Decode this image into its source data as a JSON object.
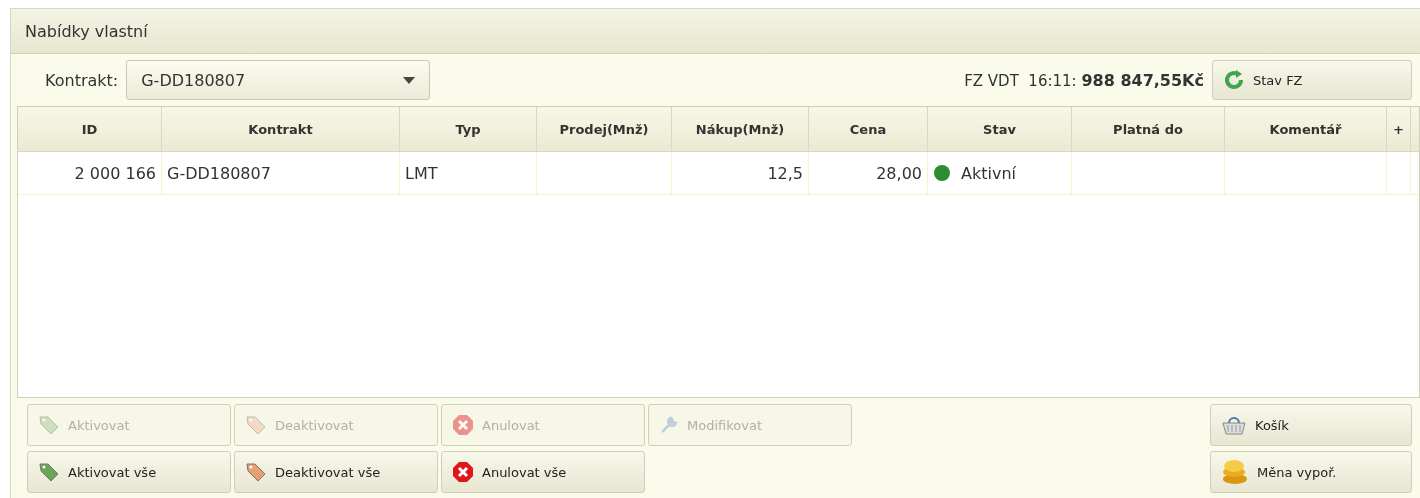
{
  "panel": {
    "title": "Nabídky vlastní"
  },
  "contract": {
    "label": "Kontrakt:",
    "value": "G-DD180807"
  },
  "balance": {
    "label": "FZ VDT  16:11:",
    "amount": "988 847,55Kč"
  },
  "refresh_button": {
    "label": "Stav FZ"
  },
  "table": {
    "columns": [
      {
        "label": "ID",
        "kind": "number"
      },
      {
        "label": "Kontrakt",
        "kind": "text"
      },
      {
        "label": "Typ",
        "kind": "text"
      },
      {
        "label": "Prodej(Mnž)",
        "kind": "number"
      },
      {
        "label": "Nákup(Mnž)",
        "kind": "number"
      },
      {
        "label": "Cena",
        "kind": "number"
      },
      {
        "label": "Stav",
        "kind": "status"
      },
      {
        "label": "Platná do",
        "kind": "text"
      },
      {
        "label": "Komentář",
        "kind": "text"
      }
    ],
    "add_column": "+",
    "rows": [
      {
        "cells": [
          "2 000 166",
          "G-DD180807",
          "LMT",
          "",
          "12,5",
          "28,00",
          "Aktivní",
          "",
          ""
        ],
        "color": "#2e8b2e",
        "selected": false
      }
    ]
  },
  "actions": [
    {
      "label": "Aktivovat",
      "disabled": true
    },
    {
      "label": "Deaktivovat",
      "disabled": true
    },
    {
      "label": "Anulovat",
      "disabled": true
    },
    {
      "label": "Modifikovat",
      "disabled": true
    },
    {
      "label": "Aktivovat vše",
      "disabled": false
    },
    {
      "label": "Deaktivovat vše",
      "disabled": false
    },
    {
      "label": "Anulovat vše",
      "disabled": false
    }
  ],
  "side_actions": [
    {
      "label": "Košík"
    },
    {
      "label": "Měna vypoř."
    }
  ]
}
